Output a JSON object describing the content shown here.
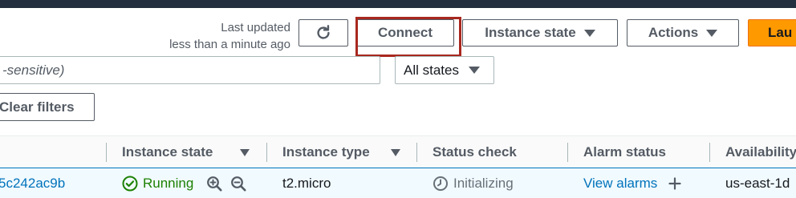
{
  "header": {
    "last_updated_line1": "Last updated",
    "last_updated_line2": "less than a minute ago"
  },
  "toolbar": {
    "refresh_icon": "refresh-icon",
    "connect_label": "Connect",
    "instance_state_label": "Instance state",
    "actions_label": "Actions",
    "launch_label": "Lau",
    "highlight_color": "#a8281f",
    "launch_color": "#ff9900"
  },
  "filters": {
    "search_placeholder": "-sensitive)",
    "state_select_value": "All states",
    "clear_label": "Clear filters"
  },
  "table": {
    "columns": [
      {
        "label": "Instance state",
        "sortable": true
      },
      {
        "label": "Instance type",
        "sortable": true
      },
      {
        "label": "Status check",
        "sortable": false
      },
      {
        "label": "Alarm status",
        "sortable": false
      },
      {
        "label": "Availability",
        "sortable": false
      }
    ],
    "rows": [
      {
        "instance_id": "5c242ac9b",
        "state": "Running",
        "type": "t2.micro",
        "status_check": "Initializing",
        "alarm": "View alarms",
        "zone": "us-east-1d"
      }
    ]
  }
}
